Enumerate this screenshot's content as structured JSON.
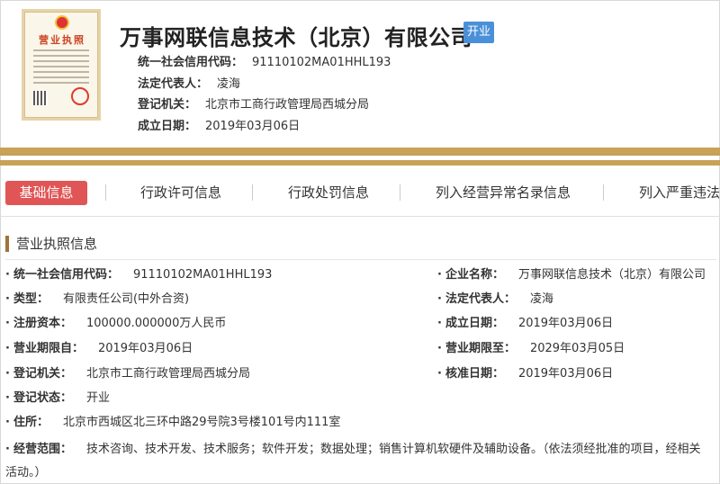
{
  "header": {
    "license_title": "营业执照",
    "company_name": "万事网联信息技术（北京）有限公司",
    "status": "开业",
    "fields": [
      {
        "label": "统一社会信用代码：",
        "value": "91110102MA01HHL193"
      },
      {
        "label": "法定代表人：",
        "value": "凌海"
      },
      {
        "label": "登记机关：",
        "value": "北京市工商行政管理局西城分局"
      },
      {
        "label": "成立日期：",
        "value": "2019年03月06日"
      }
    ]
  },
  "tabs": [
    {
      "label": "基础信息"
    },
    {
      "label": "行政许可信息"
    },
    {
      "label": "行政处罚信息"
    },
    {
      "label": "列入经营异常名录信息"
    },
    {
      "label": "列入严重违法"
    }
  ],
  "section": {
    "title": "营业执照信息",
    "rows": [
      {
        "left": {
          "label": "统一社会信用代码：",
          "value": "91110102MA01HHL193"
        },
        "right": {
          "label": "企业名称：",
          "value": "万事网联信息技术（北京）有限公司"
        }
      },
      {
        "left": {
          "label": "类型：",
          "value": "有限责任公司(中外合资)"
        },
        "right": {
          "label": "法定代表人：",
          "value": "凌海"
        }
      },
      {
        "left": {
          "label": "注册资本：",
          "value": "100000.000000万人民币"
        },
        "right": {
          "label": "成立日期：",
          "value": "2019年03月06日"
        }
      },
      {
        "left": {
          "label": "营业期限自：",
          "value": "2019年03月06日"
        },
        "right": {
          "label": "营业期限至：",
          "value": "2029年03月05日"
        }
      },
      {
        "left": {
          "label": "登记机关：",
          "value": "北京市工商行政管理局西城分局"
        },
        "right": {
          "label": "核准日期：",
          "value": "2019年03月06日"
        }
      },
      {
        "left": {
          "label": "登记状态：",
          "value": "开业"
        }
      },
      {
        "left": {
          "label": "住所：",
          "value": "北京市西城区北三环中路29号院3号楼101号内111室"
        }
      }
    ],
    "scope": {
      "label": "经营范围：",
      "value": "技术咨询、技术开发、技术服务；软件开发；数据处理；销售计算机软硬件及辅助设备。（依法须经批准的项目，经相关",
      "continuation": "活动。）"
    }
  }
}
